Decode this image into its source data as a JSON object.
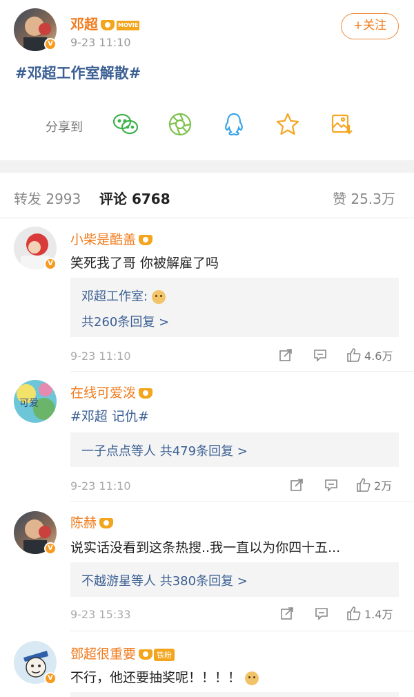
{
  "post": {
    "author": "邓超",
    "movie_badge": "MOVIE",
    "time": "9-23 11:10",
    "follow_label": "+关注",
    "hashtag": "#邓超工作室解散#",
    "share_label": "分享到",
    "share_icons": [
      "wechat-icon",
      "moments-icon",
      "qq-icon",
      "favorite-star-icon",
      "save-image-icon"
    ]
  },
  "tabs": {
    "repost_label": "转发",
    "repost_count": "2993",
    "comment_label": "评论",
    "comment_count": "6768",
    "like_label": "赞",
    "like_count": "25.3万"
  },
  "comments": [
    {
      "name": "小柴是酷盖",
      "text": "笑死我了哥 你被解雇了吗",
      "reply_line1": "邓超工作室:",
      "reply_line2": "共260条回复 >",
      "time": "9-23 11:10",
      "likes": "4.6万"
    },
    {
      "name": "在线可爱泼",
      "text": "#邓超 记仇#",
      "reply_names": "一子点点等人",
      "reply_count": "共479条回复 >",
      "time": "9-23 11:10",
      "likes": "2万"
    },
    {
      "name": "陈赫",
      "text": "说实话没看到这条热搜..我一直以为你四十五...",
      "reply_names": "不越游星等人",
      "reply_count": "共380条回复 >",
      "time": "9-23 15:33",
      "likes": "1.4万"
    },
    {
      "name": "鄧超很重要",
      "fan_badge": "铁粉",
      "text": "不行，他还要抽奖呢！！！！"
    }
  ],
  "colors": {
    "accent": "#f07a1b",
    "link": "#3b5f93",
    "verified": "#f79a1d"
  }
}
